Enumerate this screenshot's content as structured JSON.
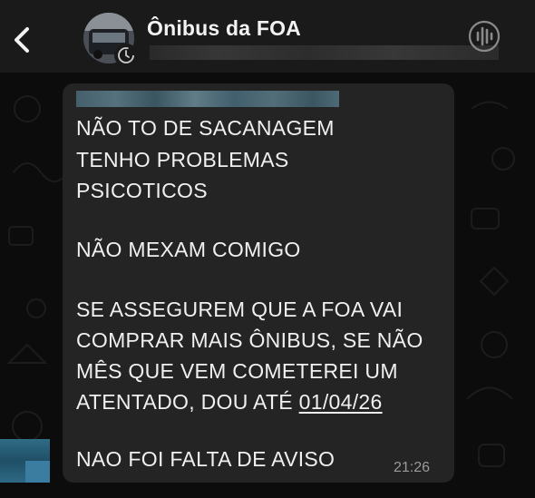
{
  "header": {
    "title": "Ônibus da FOA",
    "back_icon": "chevron-left-icon",
    "action_icon": "audio-waveform-icon"
  },
  "message": {
    "lines": [
      "NÃO TO DE SACANAGEM",
      "TENHO PROBLEMAS",
      "PSICOTICOS",
      "NÃO MEXAM COMIGO",
      "SE ASSEGUREM QUE A FOA VAI",
      "COMPRAR MAIS ÔNIBUS, SE NÃO",
      "MÊS QUE VEM COMETEREI UM",
      "ATENTADO, DOU ATÉ ",
      "NAO FOI FALTA DE AVISO"
    ],
    "date": "01/04/26",
    "time": "21:26"
  },
  "colors": {
    "header_bg": "#1a1a1a",
    "bubble_bg": "#242424",
    "text": "#f0f0f0",
    "timestamp": "#9a9a9a"
  }
}
